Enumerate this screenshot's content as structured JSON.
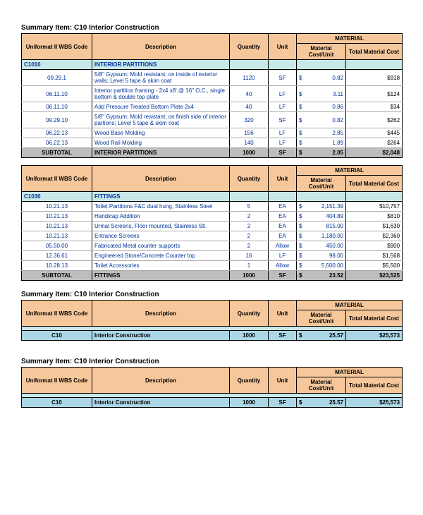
{
  "titles": {
    "t1": "Summary Item:  C10  Interior Construction",
    "t2": "Summary Item:  C10  Interior Construction",
    "t3": "Summary Item:  C10  Interior Construction"
  },
  "headers": {
    "code": "Uniformat II WBS Code",
    "desc": "Description",
    "qty": "Quantity",
    "unit": "Unit",
    "material": "MATERIAL",
    "mcu": "Material Cost/Unit",
    "tmc": "Total Material Cost",
    "subtotal": "SUBTOTAL"
  },
  "sec1": {
    "catcode": "C1010",
    "catdesc": "INTERIOR PARTITIONS",
    "rows": [
      {
        "code": "09.29.1",
        "desc": "5/8\" Gypsum; Mold resistant; on inside of exterior walls; Level 5 tape & skim coat",
        "qty": "1120",
        "unit": "SF",
        "mcu": "0.82",
        "tmc": "$918"
      },
      {
        "code": "06.11.10",
        "desc": "Interior partition framing - 2x4 x8' @ 16\" O.C., single bottom & double top plate",
        "qty": "40",
        "unit": "LF",
        "mcu": "3.11",
        "tmc": "$124"
      },
      {
        "code": "06.11.10",
        "desc": "Add Pressure Treated Bottom Plate 2x4",
        "qty": "40",
        "unit": "LF",
        "mcu": "0.86",
        "tmc": "$34"
      },
      {
        "code": "09.29.10",
        "desc": "5/8\" Gypsum; Mold resistant; on finish side of interior partions; Level 5 tape & skim coat",
        "qty": "320",
        "unit": "SF",
        "mcu": "0.82",
        "tmc": "$262"
      },
      {
        "code": "06.22.13",
        "desc": "Wood Base Molding",
        "qty": "156",
        "unit": "LF",
        "mcu": "2.85",
        "tmc": "$445"
      },
      {
        "code": "06.22.13",
        "desc": "Wood Rail Molding",
        "qty": "140",
        "unit": "LF",
        "mcu": "1.89",
        "tmc": "$264"
      }
    ],
    "sub": {
      "desc": "INTERIOR PARTITIONS",
      "qty": "1000",
      "unit": "SF",
      "mcu": "2.05",
      "tmc": "$2,048"
    }
  },
  "sec2": {
    "catcode": "C1030",
    "catdesc": "FITTINGS",
    "rows": [
      {
        "code": "10.21.13",
        "desc": "Toilet Partitions F&C dual hung, Stainless Steel",
        "qty": "5",
        "unit": "EA",
        "mcu": "2,151.39",
        "tmc": "$10,757"
      },
      {
        "code": "10.21.13",
        "desc": "Handicap Addition",
        "qty": "2",
        "unit": "EA",
        "mcu": "404.89",
        "tmc": "$810"
      },
      {
        "code": "10.21.13",
        "desc": "Urinal Screens, Floor mounted, Stainless Stl.",
        "qty": "2",
        "unit": "EA",
        "mcu": "815.00",
        "tmc": "$1,630"
      },
      {
        "code": "10.21.13",
        "desc": "Entrance Screens",
        "qty": "2",
        "unit": "EA",
        "mcu": "1,180.00",
        "tmc": "$2,360"
      },
      {
        "code": "05.50.00",
        "desc": "Fabricated Metal counter supports",
        "qty": "2",
        "unit": "Allow",
        "mcu": "450.00",
        "tmc": "$900"
      },
      {
        "code": "12.36.61",
        "desc": "Engineered Stone/Concrete Counter top",
        "qty": "16",
        "unit": "LF",
        "mcu": "98.00",
        "tmc": "$1,568"
      },
      {
        "code": "10.28.13",
        "desc": "Toilet Accessories",
        "qty": "1",
        "unit": "Allow",
        "mcu": "5,500.00",
        "tmc": "$5,500"
      }
    ],
    "sub": {
      "desc": "FITTINGS",
      "qty": "1000",
      "unit": "SF",
      "mcu": "23.52",
      "tmc": "$23,525"
    }
  },
  "sum": {
    "code": "C10",
    "desc": "Interior Construction",
    "qty": "1000",
    "unit": "SF",
    "mcu": "25.57",
    "tmc": "$25,573"
  }
}
